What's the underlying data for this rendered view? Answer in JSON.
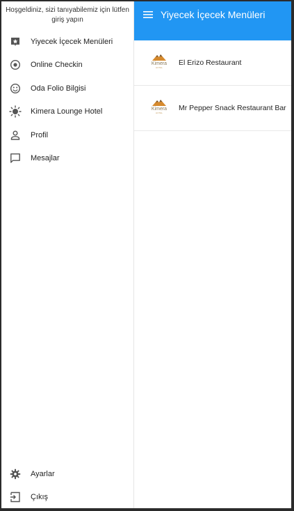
{
  "drawer": {
    "welcome": "Hoşgeldiniz, sizi tanıyabilemiz için lütfen giriş yapın",
    "items": [
      {
        "label": "Yiyecek İçecek Menüleri",
        "icon": "food-menu-icon"
      },
      {
        "label": "Online Checkin",
        "icon": "radio-target-icon"
      },
      {
        "label": "Oda Folio Bilgisi",
        "icon": "smiley-icon"
      },
      {
        "label": "Kimera Lounge Hotel",
        "icon": "sun-icon"
      },
      {
        "label": "Profil",
        "icon": "person-icon"
      },
      {
        "label": "Mesajlar",
        "icon": "message-icon"
      }
    ],
    "bottom_items": [
      {
        "label": "Ayarlar",
        "icon": "gear-icon"
      },
      {
        "label": "Çıkış",
        "icon": "logout-icon"
      }
    ]
  },
  "appbar": {
    "title": "Yiyecek İçecek Menüleri",
    "color": "#2196f3",
    "menu_icon": "hamburger-menu-icon"
  },
  "restaurants": [
    {
      "name": "El Erizo Restaurant",
      "logo_text": "Kimera",
      "logo_sub": "HOTEL"
    },
    {
      "name": "Mr Pepper Snack Restaurant Bar",
      "logo_text": "Kimera",
      "logo_sub": "HOTEL"
    }
  ]
}
